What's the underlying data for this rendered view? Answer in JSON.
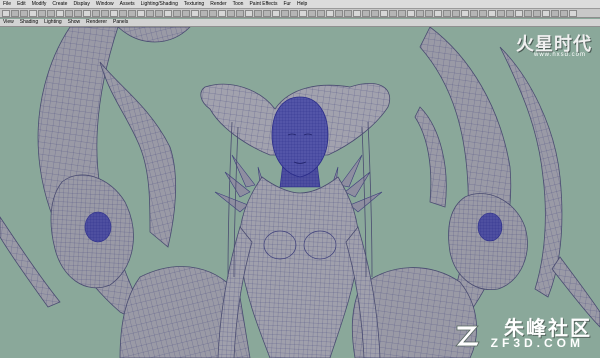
{
  "menubar": {
    "items": [
      "File",
      "Edit",
      "Modify",
      "Create",
      "Display",
      "Window",
      "Assets",
      "Lighting/Shading",
      "Texturing",
      "Render",
      "Toon",
      "Paint Effects",
      "Fur",
      "Help"
    ]
  },
  "panelbar": {
    "items": [
      "View",
      "Shading",
      "Lighting",
      "Show",
      "Renderer",
      "Panels"
    ]
  },
  "watermark_top": {
    "brand": "火星时代",
    "url": "www.hxsd.com"
  },
  "watermark_bottom": {
    "brand_cn": "朱峰社区",
    "brand_en": "ZF3D.COM"
  },
  "colors": {
    "viewport_bg": "#8aa89a",
    "mesh_fill": "#9a9aa6",
    "wire": "#3c3e7a",
    "wire_dense": "#2b2d8a"
  },
  "icons": {
    "shelf": "maya-tool-icons",
    "badge": "zf-logo-icon"
  }
}
